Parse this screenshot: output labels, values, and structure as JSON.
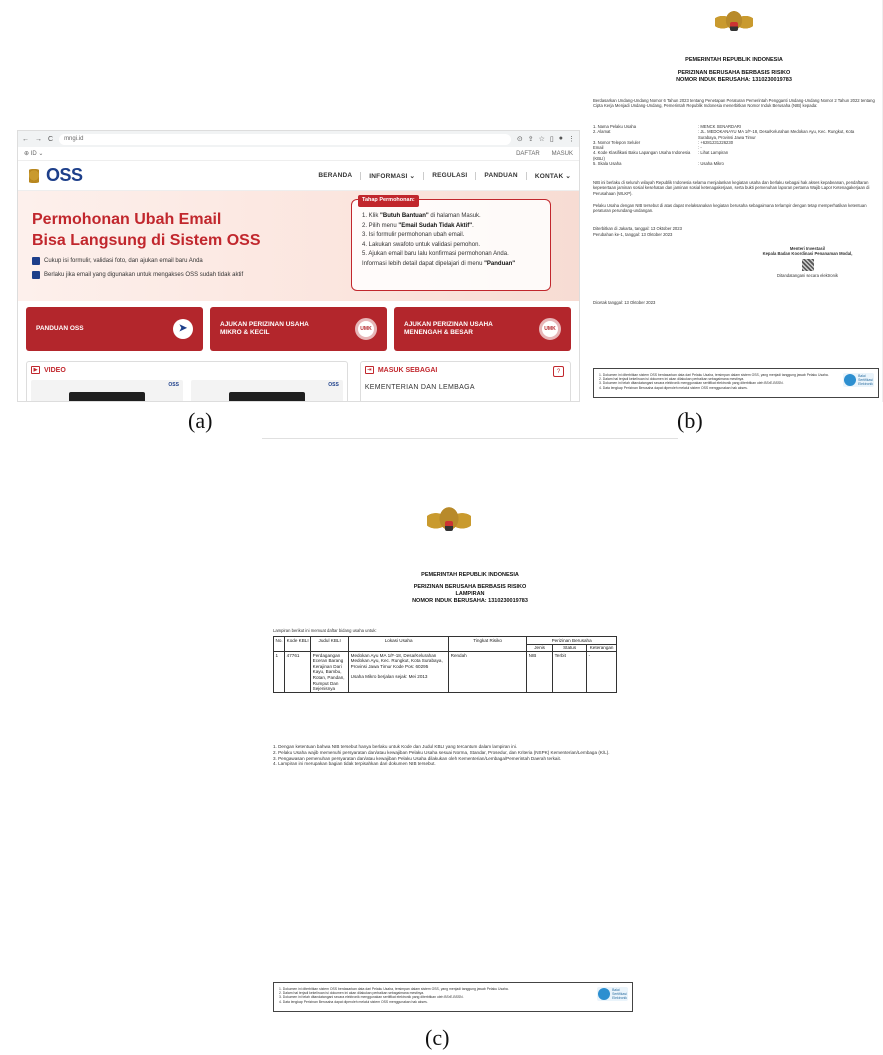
{
  "browser": {
    "nav_buttons": [
      "←",
      "→",
      "C"
    ],
    "url": "mngi.id",
    "zoom_text": "⊕ ID ⌄",
    "top_links": [
      "DAFTAR",
      "MASUK"
    ],
    "logo_text": "OSS",
    "menu": [
      "BERANDA",
      "INFORMASI ⌄",
      "REGULASI",
      "PANDUAN",
      "KONTAK ⌄"
    ],
    "hero": {
      "title_line1": "Permohonan Ubah Email",
      "title_line2": "Bisa Langsung di Sistem OSS",
      "bullet1": "Cukup isi formulir, validasi foto, dan ajukan email baru Anda",
      "bullet2": "Berlaku jika email yang digunakan untuk mengakses OSS sudah tidak aktif"
    },
    "tahap": {
      "tag": "Tahap Permohonan:",
      "step1_pre": "1. Klik ",
      "step1_bold": "\"Butuh Bantuan\"",
      "step1_post": " di halaman Masuk.",
      "step2_pre": "2. Pilih menu ",
      "step2_bold": "\"Email Sudah Tidak Aktif\"",
      "step2_post": ".",
      "step3": "3. Isi formulir permohonan ubah email.",
      "step4": "4. Lakukan swafoto untuk validasi pemohon.",
      "step5": "5. Ajukan email baru lalu konfirmasi permohonan Anda.",
      "info_pre": "Informasi lebih detail dapat dipelajari di menu ",
      "info_bold": "\"Panduan\""
    },
    "cards": [
      {
        "label": "PANDUAN OSS",
        "badge": "➤"
      },
      {
        "label": "AJUKAN PERIZINAN USAHA MIKRO & KECIL",
        "badge": "UMK"
      },
      {
        "label": "AJUKAN PERIZINAN USAHA MENENGAH & BESAR",
        "badge": "UMK"
      }
    ],
    "video_heading": "VIDEO",
    "thumb_label": "OSS",
    "masuk_heading": "MASUK SEBAGAI",
    "help_icon": "?",
    "masuk_item": "KEMENTERIAN DAN LEMBAGA"
  },
  "nib": {
    "header1": "PEMERINTAH REPUBLIK INDONESIA",
    "header2": "PERIZINAN BERUSAHA BERBASIS RISIKO",
    "header3": "NOMOR INDUK BERUSAHA: 1310230019783",
    "intro": "Berdasarkan Undang-Undang Nomor 6 Tahun 2023 tentang Penetapan Peraturan Pemerintah Pengganti Undang-Undang Nomor 2 Tahun 2022 tentang Cipta Kerja Menjadi Undang-Undang, Pemerintah Republik Indonesia menerbitkan Nomor Induk Berusaha (NIB) kepada:",
    "fields": [
      {
        "k": "1. Nama Pelaku Usaha",
        "v": ": MENCK SENARDARI"
      },
      {
        "k": "2. Alamat",
        "v": ": JL. MEDOKANAYU MA 1/F-18, Desa/Kelurahan Medokan Ayu, Kec. Rungkut, Kota Surabaya, Provinsi Jawa Timur"
      },
      {
        "k": "3. Nomor Telepon Seluler",
        "v": ": +6281231226230"
      },
      {
        "k": "   Email",
        "v": ": -"
      },
      {
        "k": "4. Kode Klasifikasi Baku Lapangan Usaha Indonesia (KBLI)",
        "v": ": Lihat Lampiran"
      },
      {
        "k": "5. Skala Usaha",
        "v": ": Usaha Mikro"
      }
    ],
    "para1": "NIB ini berlaku di seluruh wilayah Republik Indonesia selama menjalankan kegiatan usaha dan berlaku sebagai hak akses kepabeanan, pendaftaran kepesertaan jaminan sosial kesehatan dan jaminan sosial ketenagakerjaan, serta bukti pemenuhan laporan pertama Wajib Lapor Ketenagakerjaan di Perusahaan (WLKP).",
    "para2": "Pelaku Usaha dengan NIB tersebut di atas dapat melaksanakan kegiatan berusaha sebagaimana terlampir dengan tetap memperhatikan ketentuan peraturan perundang-undangan.",
    "issued": "Diterbitkan di Jakarta, tanggal: 13 Oktober 2023",
    "changed": "Perubahan ke-1, tanggal: 13 Oktober 2023",
    "signer1": "Menteri Investasi/",
    "signer2": "Kepala Badan Koordinasi Penanaman Modal,",
    "signed": "Ditandatangani secara elektronik",
    "printed": "Dicetak tanggal: 13 Oktober 2023",
    "footer_lines": [
      "1.   Dokumen ini diterbitkan sistem OSS berdasarkan data dari Pelaku Usaha, tersimpan dalam sistem OSS, yang menjadi tanggung jawab Pelaku Usaha.",
      "2.   Dalam hal terjadi kekeliruan isi dokumen ini akan dilakukan perbaikan sebagaimana mestinya.",
      "3.   Dokumen ini telah ditandatangani secara elektronik menggunakan sertifikat elektronik yang diterbitkan oleh BSrE-BSSN.",
      "4.   Data lengkap Perizinan Berusaha dapat diperoleh melalui sistem OSS menggunakan hak akses."
    ],
    "bsre_text": [
      "Balai",
      "Sertifikasi",
      "Elektronik"
    ]
  },
  "captions": {
    "a": "(a)",
    "b": "(b)",
    "c": "(c)"
  },
  "lampiran": {
    "header1": "PEMERINTAH REPUBLIK INDONESIA",
    "header2": "PERIZINAN BERUSAHA BERBASIS RISIKO",
    "header3": "LAMPIRAN",
    "header4": "NOMOR INDUK BERUSAHA: 1310230019783",
    "intro": "Lampiran berikut ini memuat daftar bidang usaha untuk:",
    "col_no": "No.",
    "col_kode": "Kode KBLI",
    "col_judul": "Judul KBLI",
    "col_lokasi": "Lokasi Usaha",
    "col_risiko": "Tingkat Risiko",
    "col_perizinan": "Perizinan Berusaha",
    "col_jenis": "Jenis",
    "col_status": "Status",
    "col_ket": "Keterangan",
    "row_no": "1",
    "row_kode": "47761",
    "row_judul": "Perdagangan Eceran Barang Kerajinan Dari Kayu, Bambu, Rotan, Pandan, Rumput Dan Sejenisnya",
    "row_lokasi1": "Medokan Ayu MA 1/F-18, Desa/Kelurahan Medokan Ayu, Kec. Rungkut, Kota Surabaya, Provinsi Jawa Timur Kode Pos: 60295",
    "row_lokasi2": "Usaha Mikro berjalan sejak: Mei 2013",
    "row_risiko": "Rendah",
    "row_jenis": "NIB",
    "row_status": "Terbit",
    "row_ket": "-",
    "notes": [
      "1.   Dengan ketentuan bahwa NIB tersebut hanya berlaku untuk Kode dan Judul KBLI yang tercantum dalam lampiran ini.",
      "2.   Pelaku Usaha wajib memenuhi persyaratan dan/atau kewajiban Pelaku Usaha sesuai Norma, Standar, Prosedur, dan Kriteria (NSPK) Kementerian/Lembaga (K/L).",
      "3.   Pengawasan pemenuhan persyaratan dan/atau kewajiban Pelaku Usaha dilakukan oleh Kementerian/Lembaga/Pemerintah Daerah terkait.",
      "4.   Lampiran ini merupakan bagian tidak terpisahkan dari dokumen NIB tersebut."
    ]
  },
  "colors": {
    "accent_red": "#c1272d",
    "card_red": "#b3262c",
    "brand_blue": "#1d3f8a"
  }
}
